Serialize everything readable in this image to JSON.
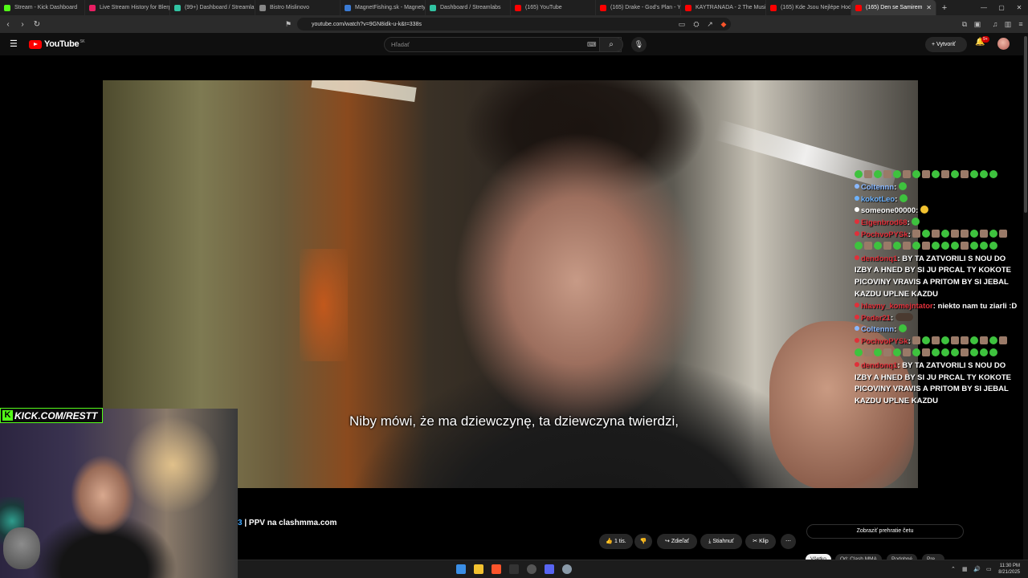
{
  "browser": {
    "tabs": [
      {
        "label": "Stream - Kick Dashboard",
        "color": "#53fc18"
      },
      {
        "label": "Live Stream History for Blerp S",
        "color": "#e91e63"
      },
      {
        "label": "(99+) Dashboard / Streamlabs",
        "color": "#31c3a2"
      },
      {
        "label": "Bistro Mislinovo",
        "color": "#888888"
      },
      {
        "label": "MagnetFishing.sk - Magnety a",
        "color": "#3a7bd5"
      },
      {
        "label": "Dashboard / Streamlabs",
        "color": "#31c3a2"
      },
      {
        "label": "(165) YouTube",
        "color": "#ff0000"
      },
      {
        "label": "(165) Drake - God's Plan - You",
        "color": "#ff0000"
      },
      {
        "label": "KAYTRANADA - 2 The Music (",
        "color": "#ff0000"
      },
      {
        "label": "(165) Kde Jsou Nejlépe Hodnoc",
        "color": "#ff0000"
      },
      {
        "label": "(165) Den se Samirem",
        "color": "#ff0000",
        "active": true
      }
    ],
    "url": "youtube.com/watch?v=9GN8idk-u-k&t=338s"
  },
  "youtube": {
    "logo_text": "YouTube",
    "region": "SK",
    "search_placeholder": "Hľadať",
    "create_label": "Vytvoriť",
    "notifications_badge": "9+"
  },
  "video": {
    "subtitle": "Niby mówi, że ma dziewczynę, ta dziewczyna twierdzi,",
    "title_episode": "3",
    "title_rest": " | PPV na clashmma.com"
  },
  "actions": {
    "like_count": "1 tis.",
    "share_label": "Zdieľať",
    "download_label": "Stiahnuť",
    "clip_label": "Klip",
    "chat_replay": "Zobraziť prehratie četu"
  },
  "chips": [
    "Všetko",
    "Od: Clash MMA",
    "Podobné",
    "Pre..."
  ],
  "overlay": {
    "kick_url": "KICK.COM/RESTT"
  },
  "chat": [
    {
      "type": "emotes",
      "emotes": [
        "g",
        "b",
        "g",
        "b",
        "g",
        "b",
        "g",
        "b",
        "g",
        "b",
        "g",
        "b",
        "g",
        "g",
        "g"
      ]
    },
    {
      "user": "Coltennn",
      "color": "#8ab8ff",
      "text": "",
      "emotes": [
        "g"
      ]
    },
    {
      "user": "kokotLeo",
      "color": "#6db3ff",
      "text": "",
      "emotes": [
        "g"
      ]
    },
    {
      "user": "someone00000",
      "color": "#ffffff",
      "text": "",
      "emotes": [
        "y"
      ]
    },
    {
      "user": "Eigenbrod68",
      "color": "#e0303a",
      "text": "",
      "emotes": [
        "g"
      ]
    },
    {
      "user": "PochvoPYSk",
      "color": "#e0303a",
      "text": "",
      "emotes": [
        "b",
        "g",
        "b",
        "g",
        "b",
        "b",
        "g",
        "b",
        "g",
        "b"
      ]
    },
    {
      "type": "emotes",
      "emotes": [
        "g",
        "b",
        "g",
        "b",
        "g",
        "b",
        "g",
        "b",
        "g",
        "g",
        "g",
        "b",
        "g",
        "g",
        "g"
      ]
    },
    {
      "user": "dendonq1",
      "color": "#e0303a",
      "text": "BY TA ZATVORILI S NOU DO IZBY A HNED BY SI JU PRCAL TY KOKOTE PICOVINY VRAVIS A PRITOM BY SI JEBAL KAZDU UPLNE KAZDU",
      "emotes": []
    },
    {
      "user": "hlavny_komejntator",
      "color": "#e0303a",
      "text": "niekto nam tu ziarli :D",
      "emotes": []
    },
    {
      "user": "Peder21",
      "color": "#e0303a",
      "text": "",
      "emotes": [
        "br"
      ]
    },
    {
      "user": "Coltennn",
      "color": "#8ab8ff",
      "text": "",
      "emotes": [
        "g"
      ]
    },
    {
      "user": "PochvoPYSk",
      "color": "#e0303a",
      "text": "",
      "emotes": [
        "b",
        "g",
        "b",
        "g",
        "b",
        "b",
        "g",
        "b",
        "g",
        "b"
      ]
    },
    {
      "type": "emotes",
      "emotes": [
        "g",
        "b",
        "g",
        "b",
        "g",
        "b",
        "g",
        "b",
        "g",
        "g",
        "g",
        "b",
        "g",
        "g",
        "g"
      ]
    },
    {
      "user": "dendonq1",
      "color": "#e0303a",
      "text": "BY TA ZATVORILI S NOU DO IZBY A HNED BY SI JU PRCAL TY KOKOTE PICOVINY VRAVIS A PRITOM BY SI JEBAL KAZDU UPLNE KAZDU",
      "emotes": []
    }
  ],
  "taskbar": {
    "time": "11:30 PM",
    "date": "8/21/2025"
  }
}
